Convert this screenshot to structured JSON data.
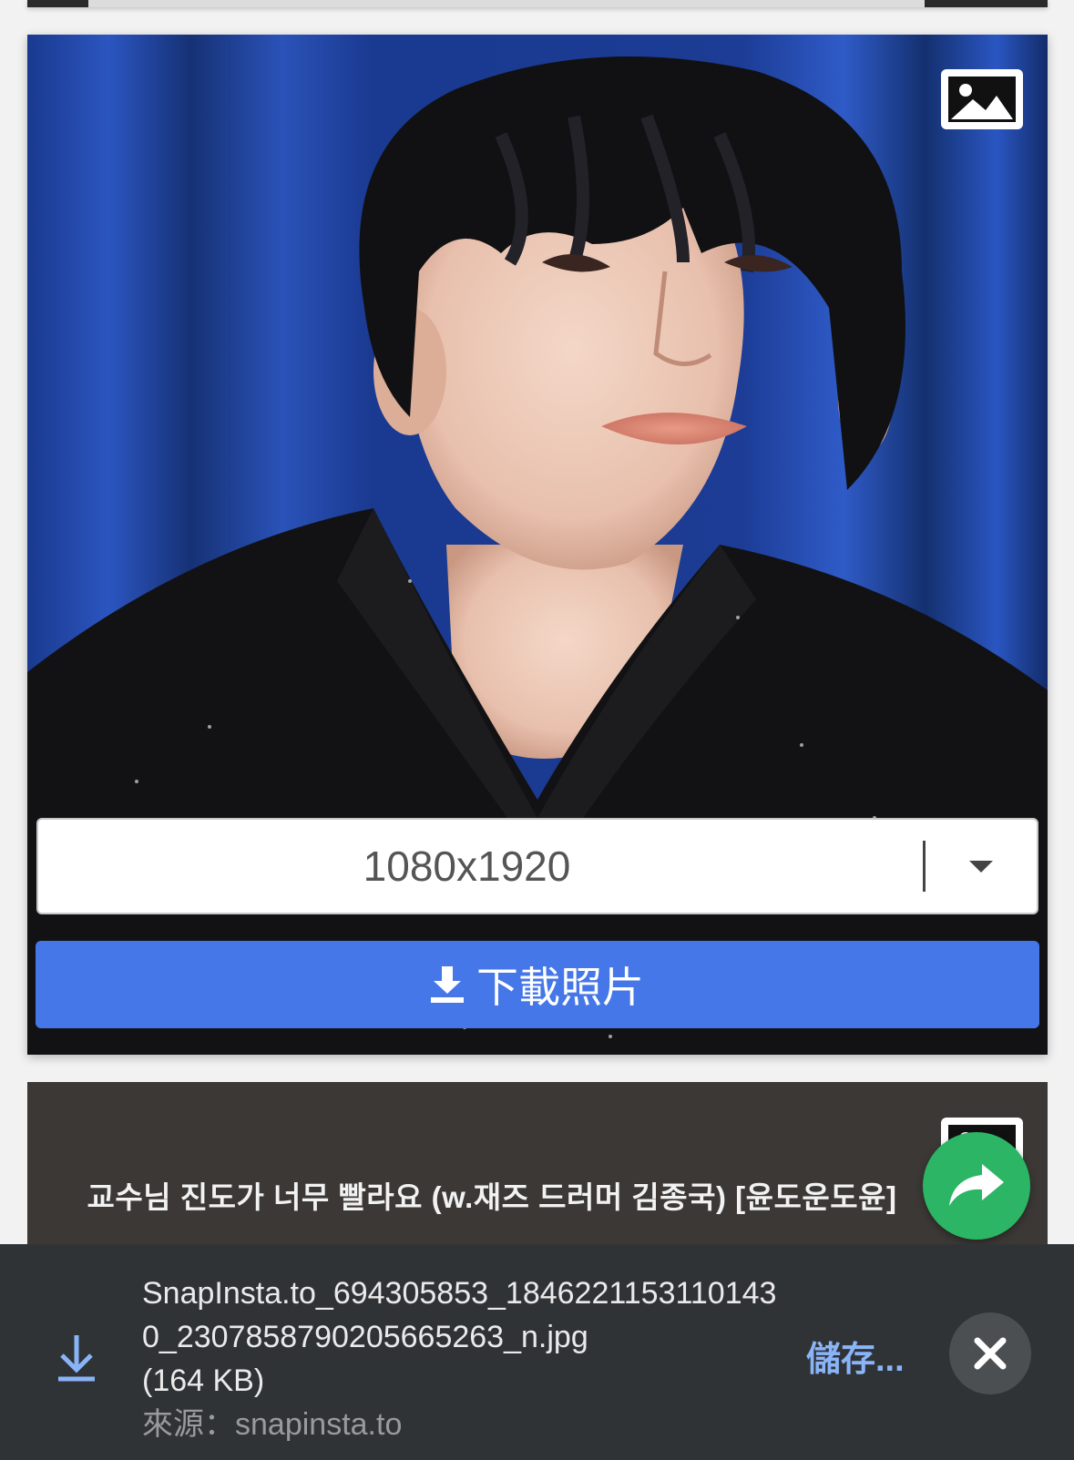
{
  "main_card": {
    "resolution_selected": "1080x1920",
    "download_label": "下載照片",
    "colors": {
      "button": "#4677e8",
      "backdrop": "#1c3f9a"
    }
  },
  "second_card": {
    "caption": "교수님 진도가 너무 빨라요 (w.재즈 드러머 김종국) [윤도운도윤]"
  },
  "share_button": {
    "icon": "share-arrow-icon",
    "color": "#2bb565"
  },
  "download_bar": {
    "filename": "SnapInsta.to_694305853_18462211531101430_2307858790205665263_n.jpg",
    "size": "(164 KB)",
    "source": "來源：snapinsta.to",
    "save_label": "儲存...",
    "close_icon": "close-icon"
  }
}
